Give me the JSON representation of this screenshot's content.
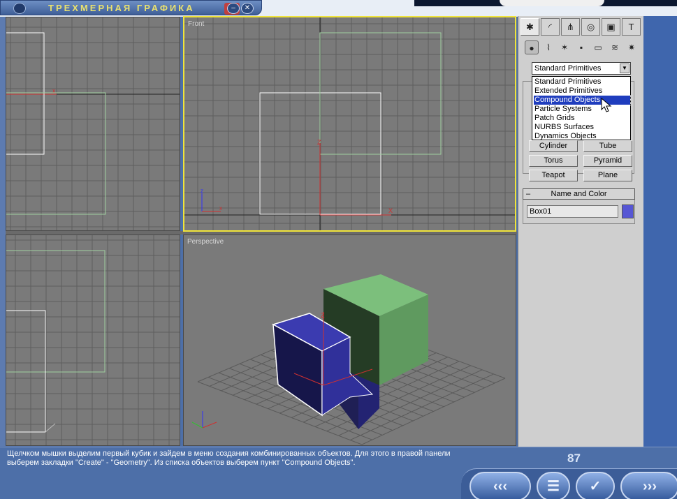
{
  "window": {
    "title": "ТРЕХМЕРНАЯ ГРАФИКА",
    "min_glyph": "–",
    "close_glyph": "✕"
  },
  "viewports": {
    "front": "Front",
    "perspective": "Perspective"
  },
  "panel": {
    "tabs": [
      {
        "icon": "create-tab-icon",
        "glyph": "✱"
      },
      {
        "icon": "modify-tab-icon",
        "glyph": "◜"
      },
      {
        "icon": "hierarchy-tab-icon",
        "glyph": "⋔"
      },
      {
        "icon": "motion-tab-icon",
        "glyph": "◎"
      },
      {
        "icon": "display-tab-icon",
        "glyph": "▣"
      },
      {
        "icon": "utilities-tab-icon",
        "glyph": "T"
      }
    ],
    "categories": [
      {
        "icon": "geometry-icon",
        "glyph": "●"
      },
      {
        "icon": "shapes-icon",
        "glyph": "⌇"
      },
      {
        "icon": "lights-icon",
        "glyph": "✶"
      },
      {
        "icon": "cameras-icon",
        "glyph": "▪"
      },
      {
        "icon": "helpers-icon",
        "glyph": "▭"
      },
      {
        "icon": "spacewarps-icon",
        "glyph": "≋"
      },
      {
        "icon": "systems-icon",
        "glyph": "✷"
      }
    ],
    "dropdown_value": "Standard Primitives",
    "dropdown_options": [
      "Standard Primitives",
      "Extended Primitives",
      "Compound Objects",
      "Particle Systems",
      "Patch Grids",
      "NURBS Surfaces",
      "Dynamics Objects"
    ],
    "selected_option": "Compound Objects",
    "object_buttons": [
      "Cylinder",
      "Tube",
      "Torus",
      "Pyramid",
      "Teapot",
      "Plane"
    ],
    "rollout_title": "Name and Color",
    "rollout_collapse": "–",
    "object_name": "Box01",
    "object_color": "#5656d4"
  },
  "description": "Щелчком мышки выделим первый кубик и зайдем в меню создания комбинированных объектов. Для этого в правой панели выберем закладки \"Create\" - \"Geometry\". Из списка объектов выберем пункт \"Compound Objects\".",
  "page_number": "87",
  "nav": {
    "back": "‹‹‹",
    "menu": "☰",
    "check": "✓",
    "forward": "›››"
  },
  "colors": {
    "selected_viewport": "#f0e43a",
    "box01": "#3b3ba0",
    "box02": "#6aa86a",
    "accent": "#1f3dbe"
  }
}
